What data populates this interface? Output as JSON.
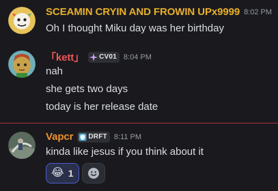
{
  "messages": [
    {
      "username": "SCEAMIN CRYIN AND FROWIN UPx9999",
      "username_color": "#e8b02c",
      "timestamp": "8:02 PM",
      "lines": [
        "Oh I thought Miku day was her birthday"
      ]
    },
    {
      "username": "「kett」",
      "username_color": "#f05658",
      "tag": "CV01",
      "timestamp": "8:04 PM",
      "lines": [
        "nah",
        "she gets two days",
        "today is her release date"
      ]
    },
    {
      "username": "Vapcr",
      "username_color": "#f0922c",
      "tag": "DRFT",
      "timestamp": "8:11 PM",
      "lines": [
        "kinda like jesus if you think about it"
      ],
      "reactions": [
        {
          "emoji": "😂",
          "count": "1"
        }
      ]
    }
  ],
  "icons": {
    "tag_cv01": "sparkle-icon",
    "tag_drft": "shield-badge-icon",
    "add_reaction": "smiley-add-icon"
  },
  "colors": {
    "background": "#1a1a1e",
    "new_messages_divider": "#a8303a",
    "reaction_active_border": "#4e5bd0"
  }
}
